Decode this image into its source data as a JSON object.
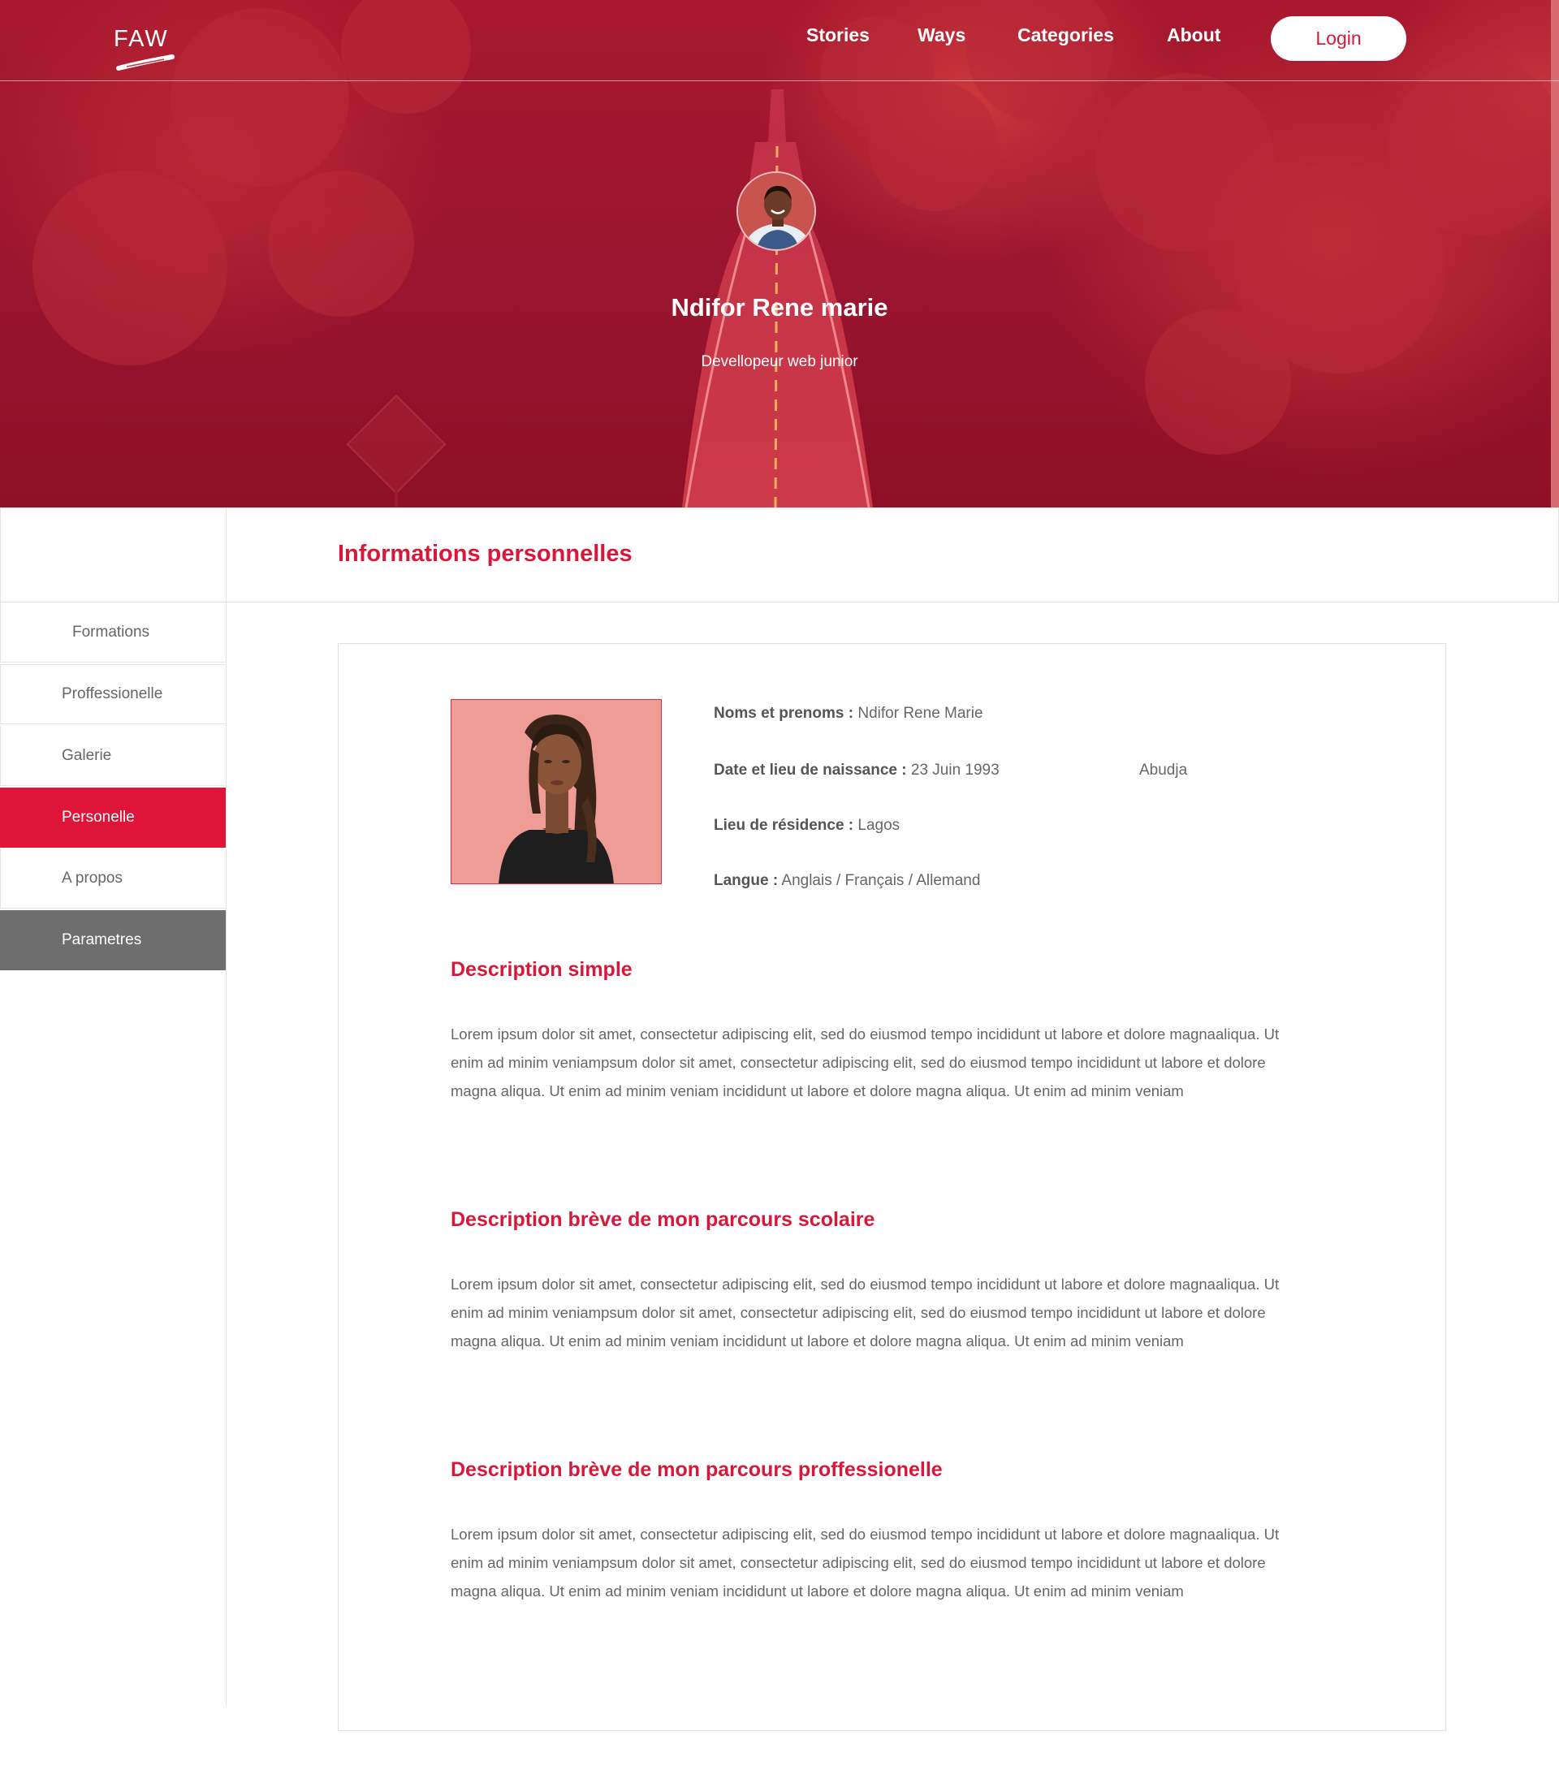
{
  "brand": {
    "logo_text": "FAW"
  },
  "nav": {
    "items": [
      "Stories",
      "Ways",
      "Categories",
      "About"
    ],
    "login_label": "Login"
  },
  "profile": {
    "name": "Ndifor Rene marie",
    "role": "Devellopeur web junior"
  },
  "section": {
    "title": "Informations personnelles"
  },
  "sidebar": {
    "items": [
      {
        "label": "Formations",
        "state": "default"
      },
      {
        "label": "Proffessionelle",
        "state": "default"
      },
      {
        "label": "Galerie",
        "state": "default"
      },
      {
        "label": "Personelle",
        "state": "active"
      },
      {
        "label": "A propos",
        "state": "default"
      },
      {
        "label": "Parametres",
        "state": "settings"
      }
    ]
  },
  "info": {
    "name_label": "Noms et prenoms :",
    "name_value": "Ndifor Rene Marie",
    "birth_label": "Date et lieu de naissance :",
    "birth_date": "23 Juin 1993",
    "birth_place": "Abudja",
    "residence_label": "Lieu de résidence :",
    "residence_value": "Lagos",
    "language_label": "Langue :",
    "language_value": "Anglais / Français / Allemand"
  },
  "descriptions": [
    {
      "title": "Description simple",
      "text": "Lorem ipsum dolor sit amet, consectetur adipiscing elit, sed do eiusmod tempo incididunt ut labore et dolore magnaaliqua. Ut enim ad minim veniampsum dolor sit amet, consectetur adipiscing elit, sed do eiusmod tempo incididunt ut labore et dolore magna aliqua. Ut enim ad minim veniam incididunt ut labore et dolore magna aliqua. Ut enim ad minim veniam"
    },
    {
      "title": "Description brève de mon parcours scolaire",
      "text": "Lorem ipsum dolor sit amet, consectetur adipiscing elit, sed do eiusmod tempo incididunt ut labore et dolore magnaaliqua. Ut enim ad minim veniampsum dolor sit amet, consectetur adipiscing elit, sed do eiusmod tempo incididunt ut labore et dolore magna aliqua. Ut enim ad minim veniam incididunt ut labore et dolore magna aliqua. Ut enim ad minim veniam"
    },
    {
      "title": "Description brève de mon parcours proffessionelle",
      "text": "Lorem ipsum dolor sit amet, consectetur adipiscing elit, sed do eiusmod tempo incididunt ut labore et dolore magnaaliqua. Ut enim ad minim veniampsum dolor sit amet, consectetur adipiscing elit, sed do eiusmod tempo incididunt ut labore et dolore magna aliqua. Ut enim ad minim veniam incididunt ut labore et dolore magna aliqua. Ut enim ad minim veniam"
    }
  ],
  "colors": {
    "accent": "#d8183a",
    "hero": "#9a1530",
    "sidebar_active": "#de1538",
    "sidebar_settings": "#6e6e6e"
  },
  "icons": [
    "faw-logo-icon",
    "avatar-photo",
    "profile-photo"
  ]
}
